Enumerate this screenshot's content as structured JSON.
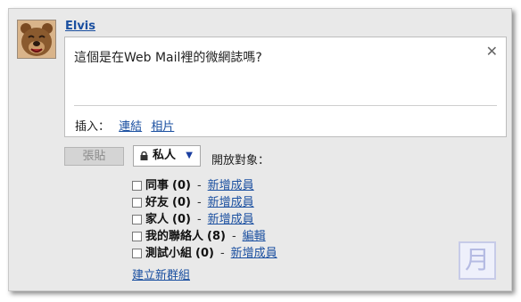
{
  "user": {
    "name": "Elvis",
    "avatar_icon": "bear-avatar-icon"
  },
  "compose": {
    "text": "這個是在Web Mail裡的微網誌嗎?",
    "close_icon": "✕",
    "insert_label": "插入：",
    "insert_links": [
      "連結",
      "相片"
    ]
  },
  "actions": {
    "paste_label": "張貼",
    "privacy_value": "私人",
    "audience_label": "開放對象："
  },
  "groups": [
    {
      "name": "同事",
      "count": "(0)",
      "link": "新增成員"
    },
    {
      "name": "好友",
      "count": "(0)",
      "link": "新增成員"
    },
    {
      "name": "家人",
      "count": "(0)",
      "link": "新增成員"
    },
    {
      "name": "我的聯絡人",
      "count": "(8)",
      "link": "編輯"
    },
    {
      "name": "測試小組",
      "count": "(0)",
      "link": "新增成員"
    }
  ],
  "group_separator": "-",
  "new_group_label": "建立新群組",
  "logo": {
    "glyph": "月",
    "icon": "moon-logo-icon"
  },
  "colors": {
    "link": "#1a4fa0",
    "panel_bg": "#e9e9e9"
  }
}
